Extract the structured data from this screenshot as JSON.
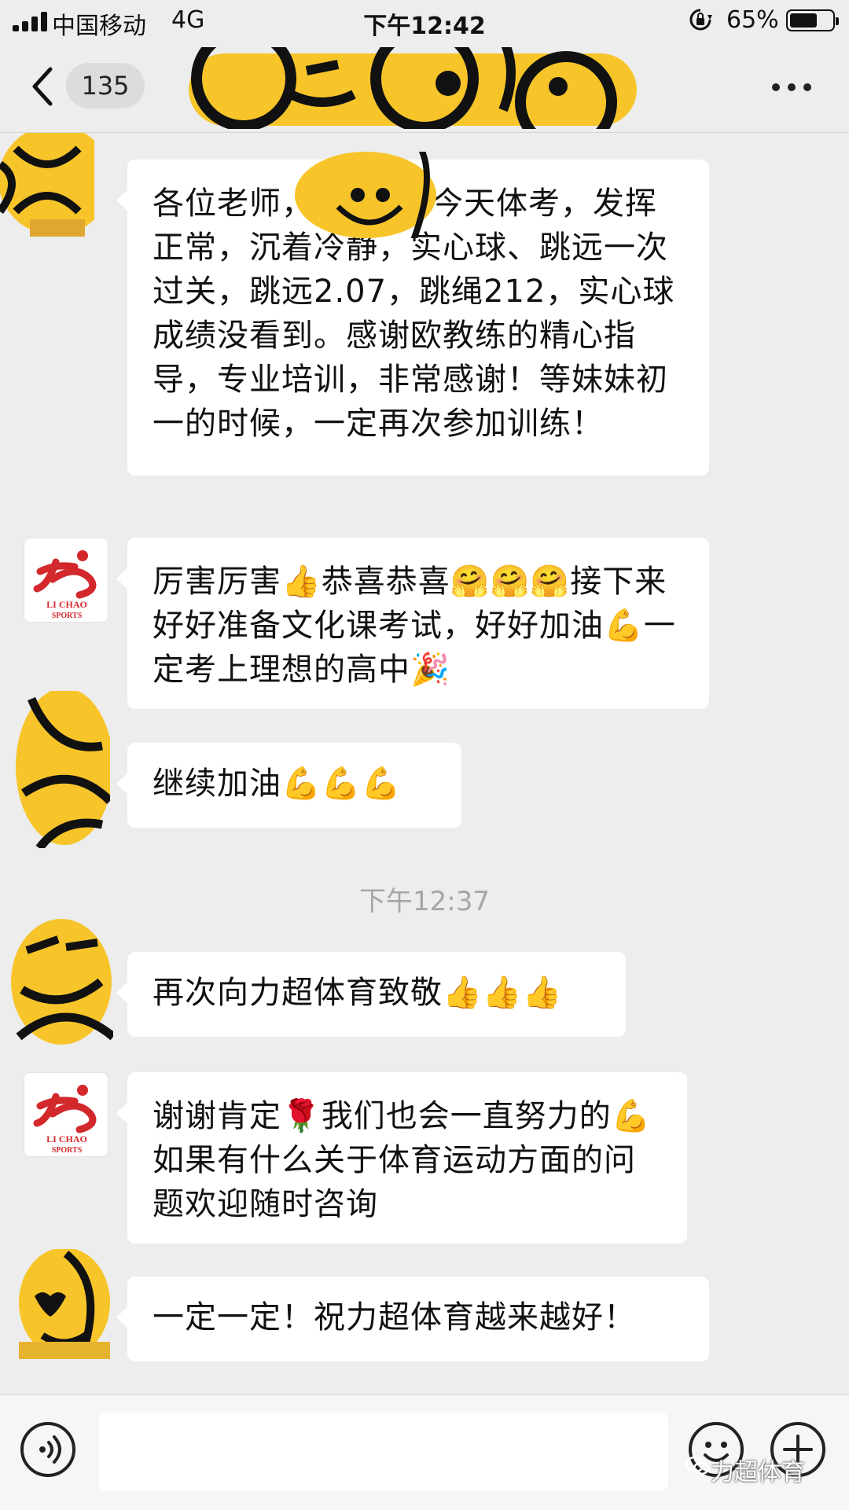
{
  "status_bar": {
    "carrier": "中国移动",
    "network": "4G",
    "time": "下午12:42",
    "battery_percent": "65%",
    "battery_level": 0.65
  },
  "nav": {
    "unread_count": "135",
    "back_icon": "chevron-left-icon",
    "more_icon": "more-dots-icon"
  },
  "messages": [
    {
      "sender": "parent",
      "avatar": "emoji-sticker-avatar",
      "parts": [
        "各位老师，",
        "今天体考，发挥正常，沉着冷静，实心球、跳远一次过关，跳远2.07，跳绳212，实心球成绩没看到。感谢欧教练的精心指导，专业培训，非常感谢！等妹妹初一的时候，一定再次参加训练！"
      ]
    },
    {
      "sender": "lichao",
      "avatar_text": [
        "LI CHAO",
        "SPORTS"
      ],
      "parts": [
        "厉害厉害",
        "👍",
        "恭喜恭喜",
        "🤗🤗🤗",
        "接下来好好准备文化课考试，好好加油",
        "💪",
        "一定考上理想的高中",
        "🎉"
      ]
    },
    {
      "sender": "parent2",
      "avatar": "emoji-sticker-avatar",
      "parts": [
        "继续加油",
        "💪💪💪"
      ]
    },
    {
      "sender": "parent3",
      "avatar": "emoji-sticker-avatar",
      "parts": [
        "再次向力超体育致敬",
        "👍👍👍"
      ]
    },
    {
      "sender": "lichao",
      "avatar_text": [
        "LI CHAO",
        "SPORTS"
      ],
      "parts": [
        "谢谢肯定",
        "🌹",
        "我们也会一直努力的",
        "💪",
        "如果有什么关于体育运动方面的问题欢迎随时咨询"
      ]
    },
    {
      "sender": "parent4",
      "avatar": "emoji-sticker-avatar",
      "parts": [
        "一定一定！祝力超体育越来越好！"
      ]
    }
  ],
  "timestamp": "下午12:37",
  "input_bar": {
    "voice_icon": "voice-icon",
    "emoji_icon": "emoji-face-icon",
    "plus_icon": "plus-icon"
  },
  "watermark": "力超体育",
  "colors": {
    "background": "#ededed",
    "bubble": "#ffffff",
    "emoji_yellow": "#f7c52a",
    "logo_red": "#d3282c"
  }
}
